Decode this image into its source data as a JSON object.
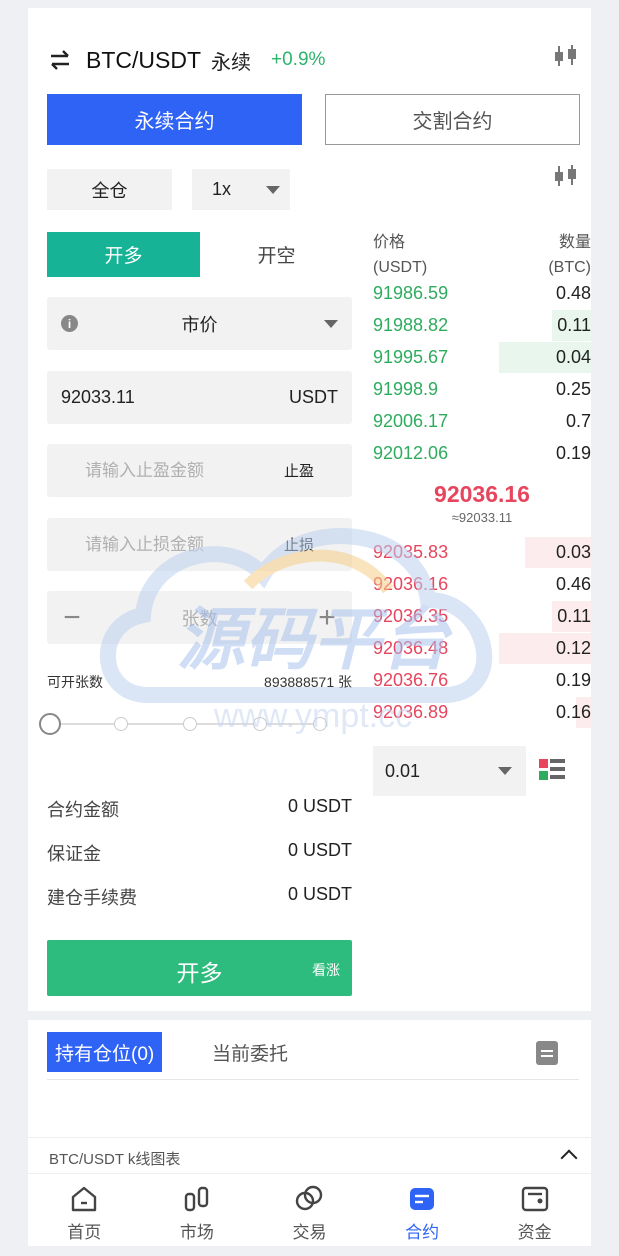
{
  "header": {
    "pair": "BTC/USDT",
    "contract_type": "永续",
    "change": "+0.9%"
  },
  "contract_tabs": {
    "perpetual": "永续合约",
    "delivery": "交割合约"
  },
  "margin_mode": "全仓",
  "leverage": "1x",
  "side_tabs": {
    "long": "开多",
    "short": "开空"
  },
  "order_type": "市价",
  "price_field": {
    "value": "92033.11",
    "unit": "USDT"
  },
  "take_profit": {
    "placeholder": "请输入止盈金额",
    "tag": "止盈"
  },
  "stop_loss": {
    "placeholder": "请输入止损金额",
    "tag": "止损"
  },
  "quantity": {
    "placeholder": "张数",
    "minus": "−",
    "plus": "+"
  },
  "available": {
    "label": "可开张数",
    "value": "893888571 张"
  },
  "slider": {
    "value_percent": 0
  },
  "summary": [
    {
      "label": "合约金额",
      "value": "0 USDT"
    },
    {
      "label": "保证金",
      "value": "0 USDT"
    },
    {
      "label": "建仓手续费",
      "value": "0 USDT"
    }
  ],
  "open_button": {
    "label": "开多",
    "hint": "看涨"
  },
  "order_book": {
    "price_header": "价格",
    "price_unit": "(USDT)",
    "qty_header": "数量",
    "qty_unit": "(BTC)",
    "bids": [
      {
        "price": "91986.59",
        "qty": "0.48",
        "depth": 0
      },
      {
        "price": "91988.82",
        "qty": "0.11",
        "depth": 0.42
      },
      {
        "price": "91995.67",
        "qty": "0.04",
        "depth": 1.0
      },
      {
        "price": "91998.9",
        "qty": "0.25",
        "depth": 0
      },
      {
        "price": "92006.17",
        "qty": "0.7",
        "depth": 0
      },
      {
        "price": "92012.06",
        "qty": "0.19",
        "depth": 0
      }
    ],
    "last_price": "92036.16",
    "last_price_approx": "≈92033.11",
    "asks": [
      {
        "price": "92035.83",
        "qty": "0.03",
        "depth": 0.72
      },
      {
        "price": "92036.16",
        "qty": "0.46",
        "depth": 0
      },
      {
        "price": "92036.35",
        "qty": "0.11",
        "depth": 0.42
      },
      {
        "price": "92036.48",
        "qty": "0.12",
        "depth": 1.0
      },
      {
        "price": "92036.76",
        "qty": "0.19",
        "depth": 0
      },
      {
        "price": "92036.89",
        "qty": "0.16",
        "depth": 0.16
      }
    ],
    "precision": "0.01"
  },
  "positions_tabs": {
    "holdings": "持有仓位(0)",
    "orders": "当前委托"
  },
  "kline_label": "BTC/USDT k线图表",
  "nav": [
    {
      "label": "首页",
      "icon": "home-icon"
    },
    {
      "label": "市场",
      "icon": "market-icon"
    },
    {
      "label": "交易",
      "icon": "trade-icon"
    },
    {
      "label": "合约",
      "icon": "contract-icon",
      "active": true
    },
    {
      "label": "资金",
      "icon": "wallet-icon"
    }
  ],
  "watermark": {
    "text": "源码平台",
    "url": "www.ympt.cc"
  },
  "colors": {
    "accent": "#2f63f6",
    "long": "#16b397",
    "buy": "#2eac5e",
    "sell": "#e7455d",
    "open_button": "#2dbb7e"
  }
}
